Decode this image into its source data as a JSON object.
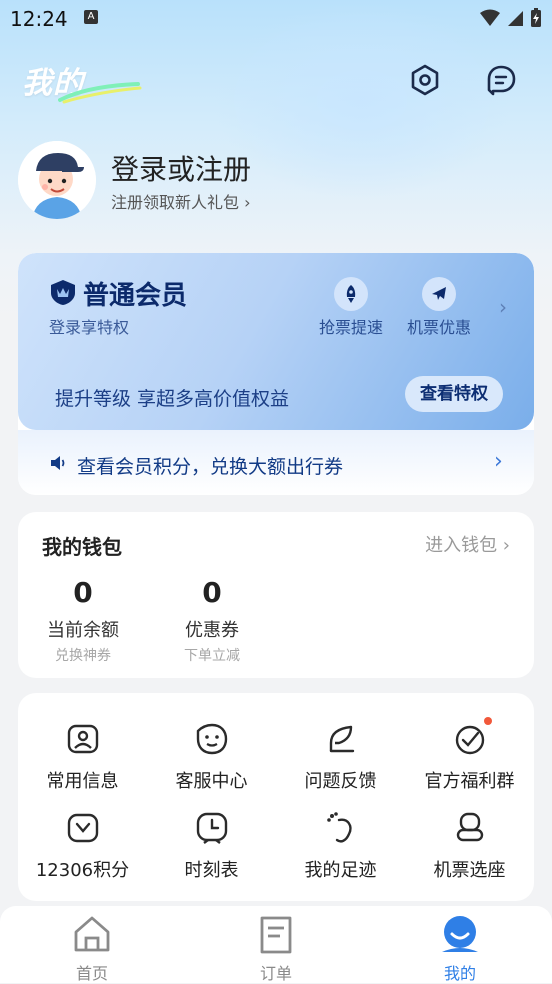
{
  "status_bar": {
    "time": "12:24",
    "notif_glyph": "A"
  },
  "header": {
    "title": "我的",
    "settings_icon": "settings-icon",
    "message_icon": "message-icon"
  },
  "profile": {
    "title": "登录或注册",
    "subtitle": "注册领取新人礼包 ›"
  },
  "member": {
    "name": "普通会员",
    "subtitle": "登录享特权",
    "perks": [
      {
        "label": "抢票提速",
        "icon": "rocket-icon"
      },
      {
        "label": "机票优惠",
        "icon": "plane-icon"
      }
    ],
    "upgrade_text": "提升等级 享超多高价值权益",
    "view_button": "查看特权",
    "points_text": "查看会员积分，兑换大额出行券"
  },
  "wallet": {
    "title": "我的钱包",
    "link": "进入钱包 ›",
    "items": [
      {
        "value": "0",
        "label": "当前余额",
        "hint": "兑换神券"
      },
      {
        "value": "0",
        "label": "优惠券",
        "hint": "下单立减"
      }
    ]
  },
  "services": [
    {
      "label": "常用信息",
      "icon": "profile-card-icon"
    },
    {
      "label": "客服中心",
      "icon": "customer-service-icon"
    },
    {
      "label": "问题反馈",
      "icon": "feedback-pen-icon"
    },
    {
      "label": "官方福利群",
      "icon": "welfare-group-icon",
      "badge": true
    },
    {
      "label": "12306积分",
      "icon": "points-wallet-icon"
    },
    {
      "label": "时刻表",
      "icon": "clock-icon"
    },
    {
      "label": "我的足迹",
      "icon": "footprint-icon"
    },
    {
      "label": "机票选座",
      "icon": "seat-icon"
    }
  ],
  "tabs": [
    {
      "label": "首页",
      "icon": "home-icon",
      "active": false
    },
    {
      "label": "订单",
      "icon": "order-icon",
      "active": false
    },
    {
      "label": "我的",
      "icon": "profile-icon",
      "active": true
    }
  ],
  "colors": {
    "accent": "#2f7fe6",
    "member_dark": "#0c2a6b",
    "badge": "#f1583a",
    "muted": "#9a9a9a"
  }
}
